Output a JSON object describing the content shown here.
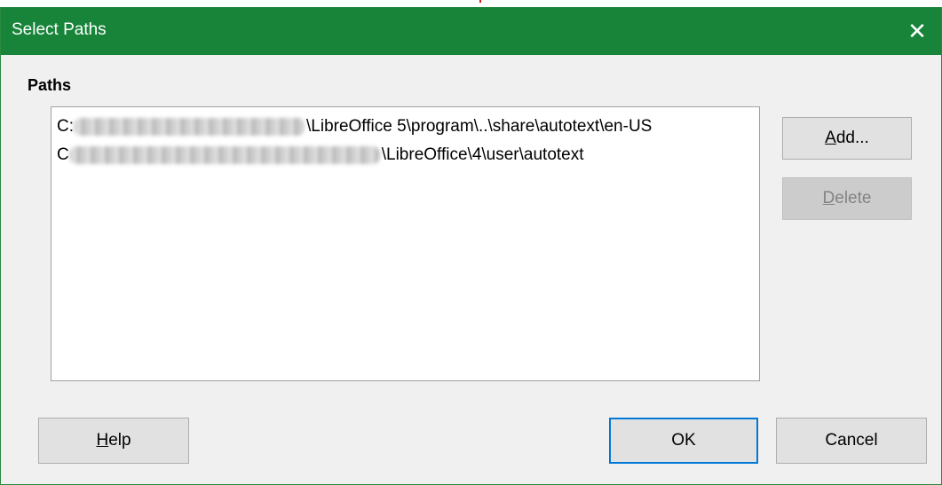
{
  "dialog": {
    "title": "Select Paths",
    "close_glyph": "✕"
  },
  "paths_section": {
    "label": "Paths",
    "items": [
      {
        "visible_text": "\\LibreOffice 5\\program\\..\\share\\autotext\\en-US",
        "prefix": "C:",
        "redacted": true
      },
      {
        "visible_text": "\\LibreOffice\\4\\user\\autotext",
        "prefix": "C",
        "redacted": true
      }
    ]
  },
  "buttons": {
    "add": {
      "mnemonic": "A",
      "rest": "dd..."
    },
    "delete": {
      "mnemonic": "D",
      "rest": "elete",
      "enabled": false
    },
    "help": {
      "mnemonic": "H",
      "rest": "elp"
    },
    "ok": "OK",
    "cancel": "Cancel"
  },
  "colors": {
    "titlebar": "#17843a",
    "accent_focus": "#0078d7"
  }
}
